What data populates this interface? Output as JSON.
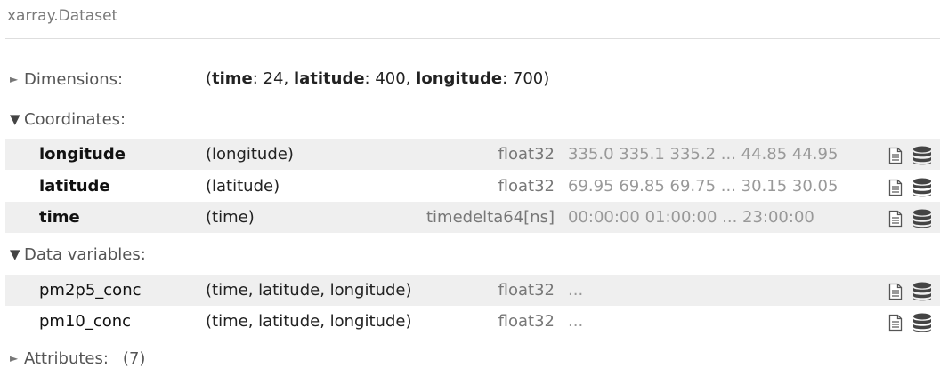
{
  "header": {
    "title": "xarray.Dataset"
  },
  "dimensions": {
    "label": "Dimensions:",
    "arrow": "►",
    "open_paren": "(",
    "items": [
      {
        "name": "time",
        "sep": ": ",
        "value": "24",
        "trail": ", "
      },
      {
        "name": "latitude",
        "sep": ": ",
        "value": "400",
        "trail": ", "
      },
      {
        "name": "longitude",
        "sep": ": ",
        "value": "700",
        "trail": ""
      }
    ],
    "close_paren": ")"
  },
  "coordinates": {
    "label": "Coordinates:",
    "arrow": "▼",
    "rows": [
      {
        "name": "longitude",
        "dims": "(longitude)",
        "dtype": "float32",
        "preview": "335.0 335.1 335.2 ... 44.85 44.95"
      },
      {
        "name": "latitude",
        "dims": "(latitude)",
        "dtype": "float32",
        "preview": "69.95 69.85 69.75 ... 30.15 30.05"
      },
      {
        "name": "time",
        "dims": "(time)",
        "dtype": "timedelta64[ns]",
        "preview": "00:00:00 01:00:00 ... 23:00:00"
      }
    ]
  },
  "data_variables": {
    "label": "Data variables:",
    "arrow": "▼",
    "rows": [
      {
        "name": "pm2p5_conc",
        "dims": "(time, latitude, longitude)",
        "dtype": "float32",
        "preview": "..."
      },
      {
        "name": "pm10_conc",
        "dims": "(time, latitude, longitude)",
        "dtype": "float32",
        "preview": "..."
      }
    ]
  },
  "attributes": {
    "label": "Attributes:",
    "arrow": "►",
    "count": "(7)"
  },
  "icons": {
    "attrs": "file-text-icon",
    "data": "database-icon"
  }
}
